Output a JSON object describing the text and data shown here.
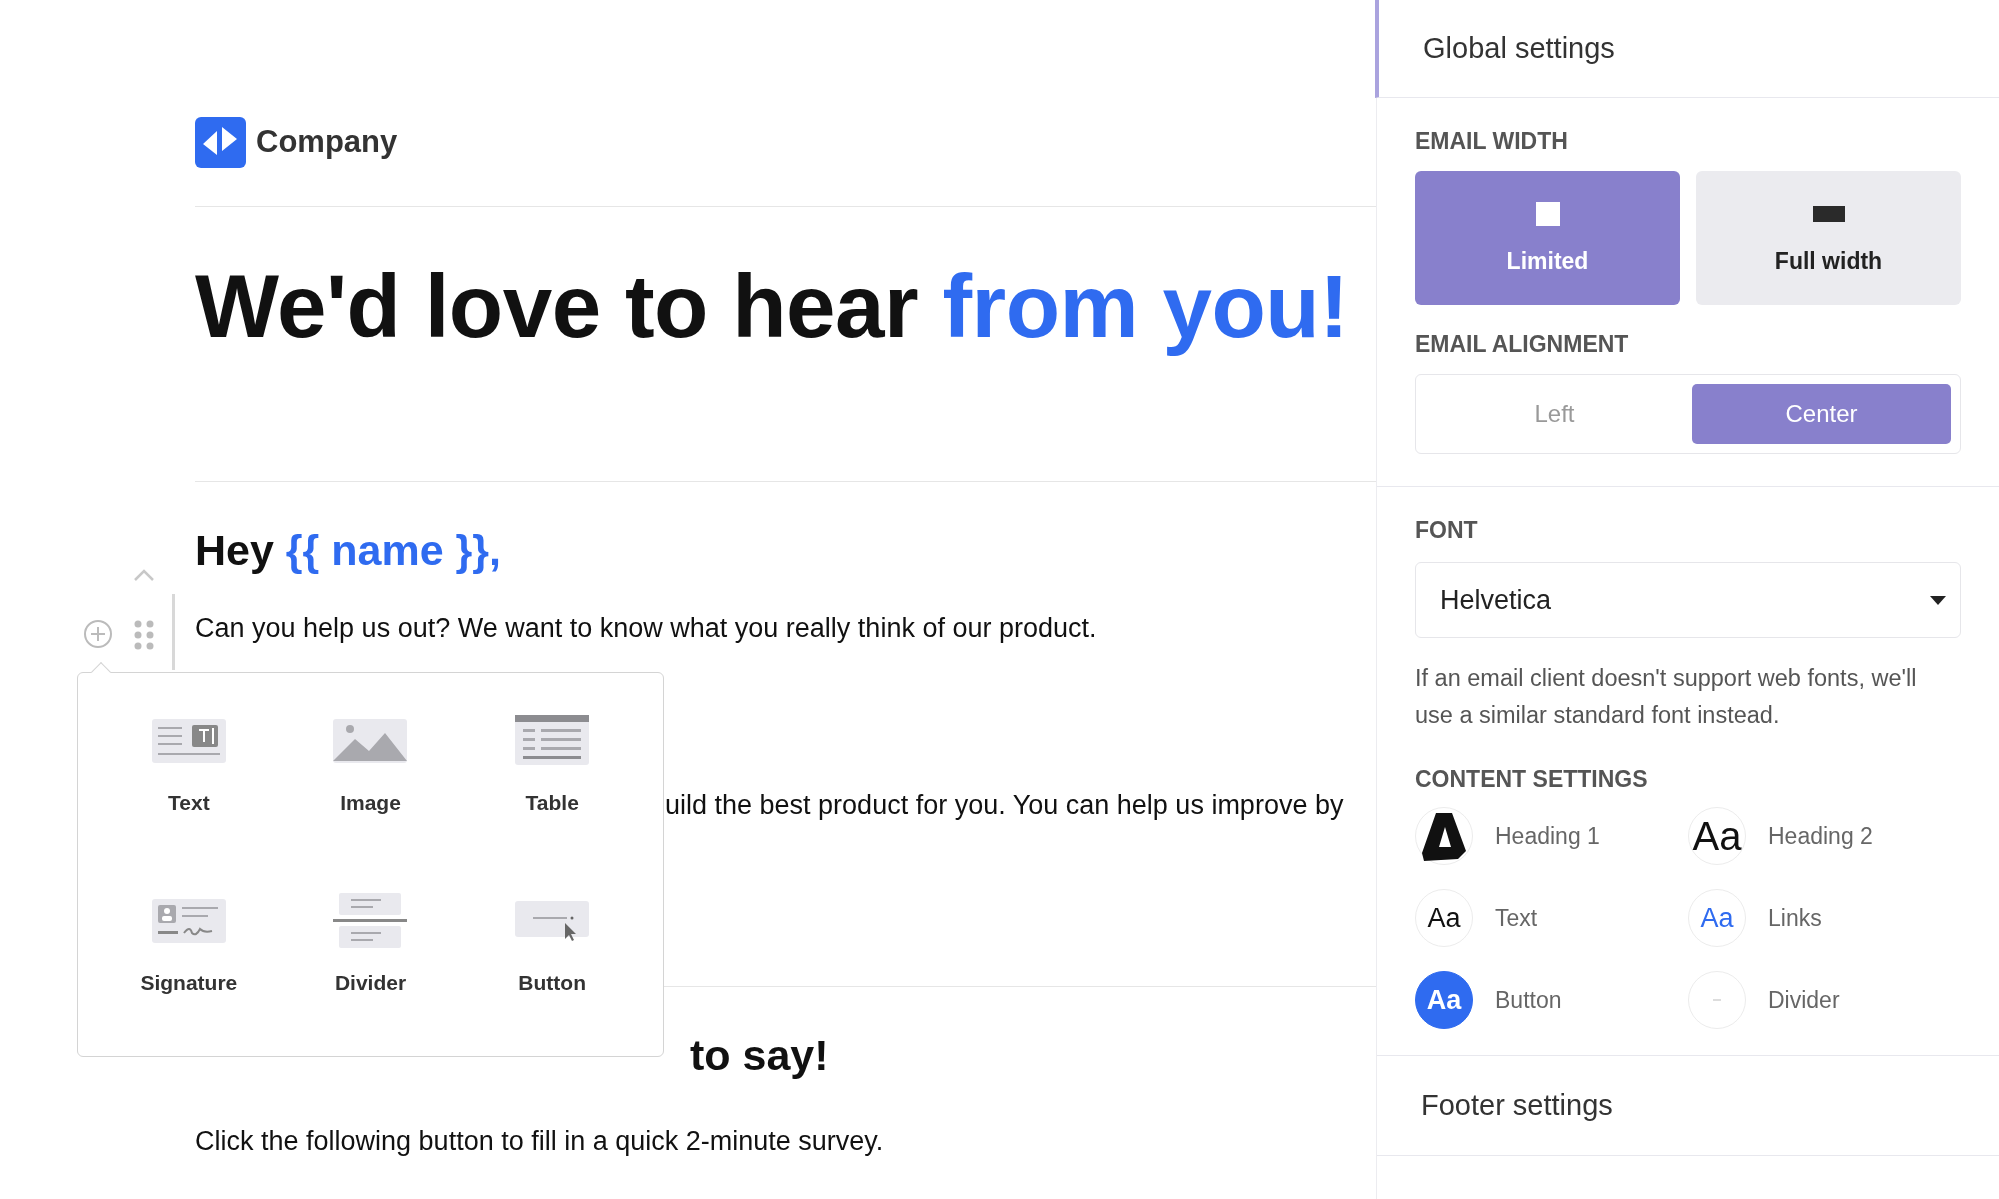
{
  "email": {
    "logo": "Company",
    "headline": [
      {
        "text": "We'd love to hear ",
        "accent": false
      },
      {
        "text": "from you!",
        "accent": true
      }
    ],
    "greeting": [
      {
        "text": "Hey ",
        "accent": false
      },
      {
        "text": "{{ name }},",
        "accent": true
      }
    ],
    "intro": "Can you help us out? We want to know what you really think of our product.",
    "partial_paragraph": "uild the best product for you. You can help us improve by",
    "subheading": "to say!",
    "cta_text": "Click the following button to fill in a quick 2-minute survey."
  },
  "block_menu": {
    "items": [
      {
        "label": "Text",
        "kind": "text"
      },
      {
        "label": "Image",
        "kind": "image"
      },
      {
        "label": "Table",
        "kind": "table"
      },
      {
        "label": "Signature",
        "kind": "signature"
      },
      {
        "label": "Divider",
        "kind": "divider"
      },
      {
        "label": "Button",
        "kind": "button"
      }
    ]
  },
  "settings": {
    "title": "Global settings",
    "email_width": {
      "label": "EMAIL WIDTH",
      "options": [
        {
          "label": "Limited",
          "kind": "limited",
          "selected": true
        },
        {
          "label": "Full width",
          "kind": "full",
          "selected": false
        }
      ]
    },
    "email_alignment": {
      "label": "EMAIL ALIGNMENT",
      "options": [
        {
          "label": "Left",
          "selected": false
        },
        {
          "label": "Center",
          "selected": true
        }
      ]
    },
    "font": {
      "label": "FONT",
      "value": "Helvetica",
      "help": "If an email client doesn't support web fonts, we'll use a similar standard font instead."
    },
    "content_settings": {
      "label": "CONTENT SETTINGS",
      "items": [
        {
          "label": "Heading 1",
          "kind": "logo"
        },
        {
          "label": "Heading 2",
          "kind": "large",
          "sample": "Aa"
        },
        {
          "label": "Text",
          "kind": "plain",
          "sample": "Aa"
        },
        {
          "label": "Links",
          "kind": "link",
          "sample": "Aa"
        },
        {
          "label": "Button",
          "kind": "filled",
          "sample": "Aa"
        },
        {
          "label": "Divider",
          "kind": "line"
        }
      ]
    },
    "footer": "Footer settings"
  }
}
